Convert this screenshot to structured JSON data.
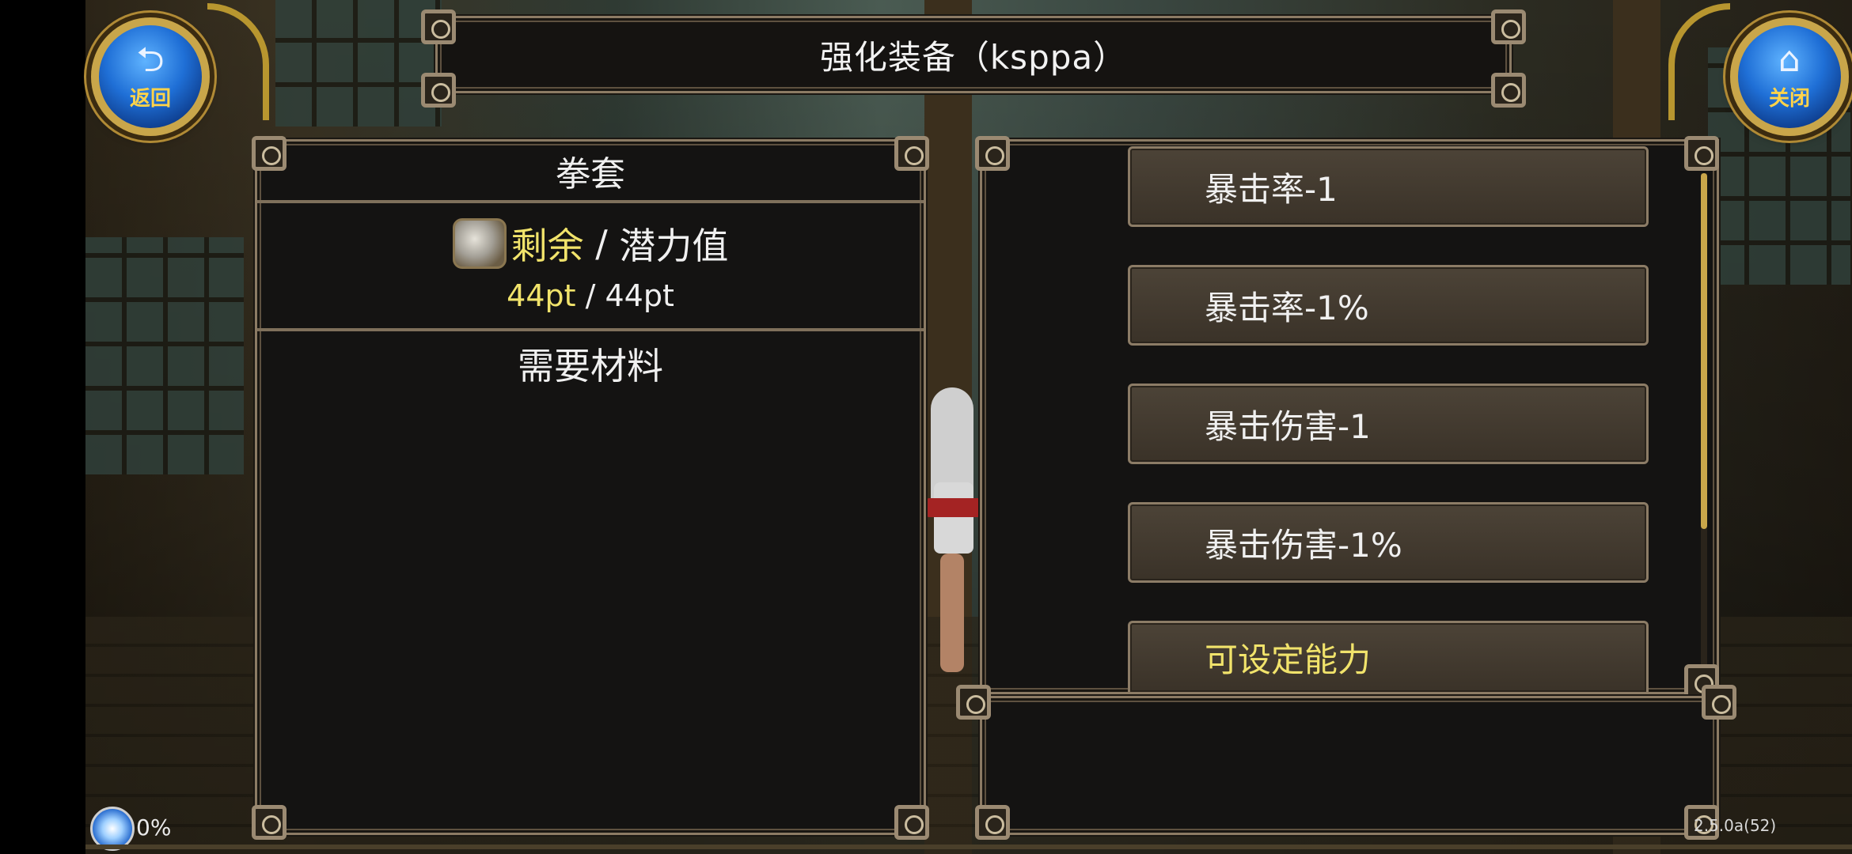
{
  "title": "强化装备（ksppa）",
  "nav": {
    "back_label": "返回",
    "back_icon": "back-arrow-icon",
    "close_label": "关闭",
    "close_icon": "home-icon"
  },
  "left_panel": {
    "header": "拳套",
    "potential_icon": "anvil-icon",
    "remaining_label": "剩余",
    "separator": " / ",
    "potential_label": "潜力值",
    "remaining_value": "44pt",
    "potential_value": "44pt",
    "materials_title": "需要材料"
  },
  "options": [
    {
      "label": "暴击率-1",
      "highlight": false
    },
    {
      "label": "暴击率-1%",
      "highlight": false
    },
    {
      "label": "暴击伤害-1",
      "highlight": false
    },
    {
      "label": "暴击伤害-1%",
      "highlight": false
    },
    {
      "label": "可设定能力",
      "highlight": true
    }
  ],
  "status": {
    "loading_percent": "0%",
    "version": "2.5.0a(52)"
  },
  "colors": {
    "highlight_text": "#f1e36b",
    "frame_border": "#8c7b64",
    "button_blue": "#1f6fd6",
    "button_gold": "#c9a64a"
  }
}
